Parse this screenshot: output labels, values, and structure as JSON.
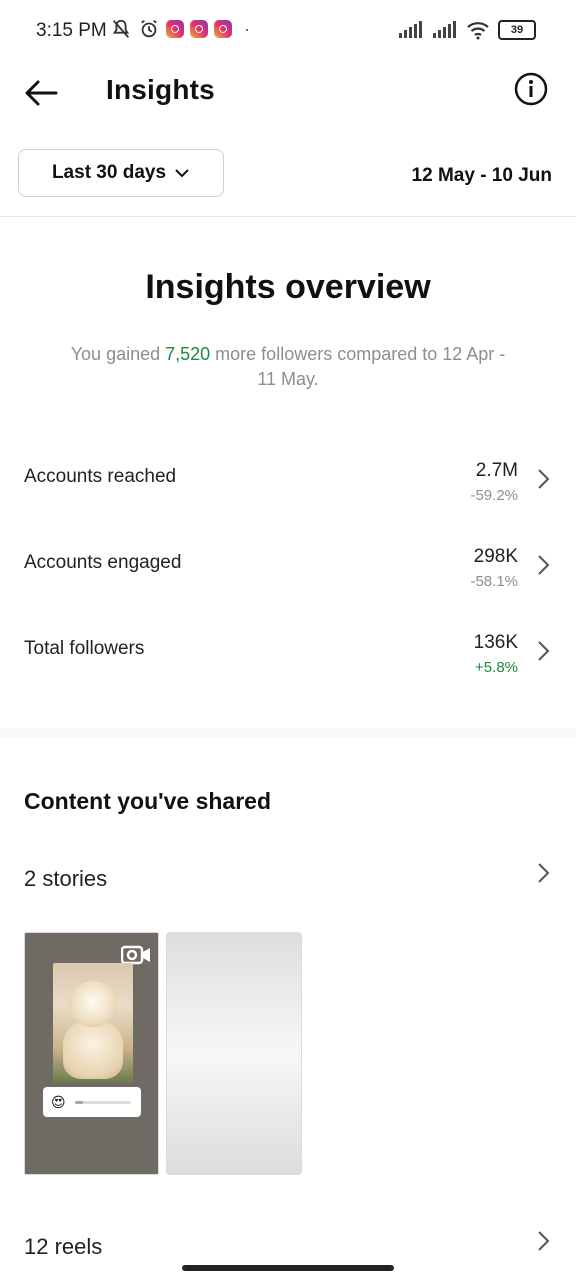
{
  "status_bar": {
    "time": "3:15 PM",
    "battery": "39",
    "icons": [
      "mute-bell-icon",
      "alarm-icon",
      "instagram-icon",
      "instagram-icon",
      "instagram-icon",
      "signal-icon",
      "signal-icon",
      "wifi-icon",
      "battery-icon"
    ]
  },
  "header": {
    "title": "Insights",
    "back_icon": "back-arrow-icon",
    "info_icon": "info-icon"
  },
  "filter": {
    "label": "Last 30 days",
    "date_range": "12 May - 10 Jun"
  },
  "overview": {
    "title": "Insights overview",
    "sub_prefix": "You gained ",
    "gained": "7,520",
    "sub_suffix": " more followers compared to 12 Apr - 11 May."
  },
  "metrics": [
    {
      "label": "Accounts reached",
      "value": "2.7M",
      "change": "-59.2%"
    },
    {
      "label": "Accounts engaged",
      "value": "298K",
      "change": "-58.1%"
    },
    {
      "label": "Total followers",
      "value": "136K",
      "change": "+5.8%"
    }
  ],
  "content": {
    "title": "Content you've shared",
    "stories_label": "2 stories",
    "reels_label": "12 reels",
    "emoji": "😍"
  },
  "colors": {
    "positive": "#1b8a3a",
    "muted": "#8e8e8e"
  }
}
